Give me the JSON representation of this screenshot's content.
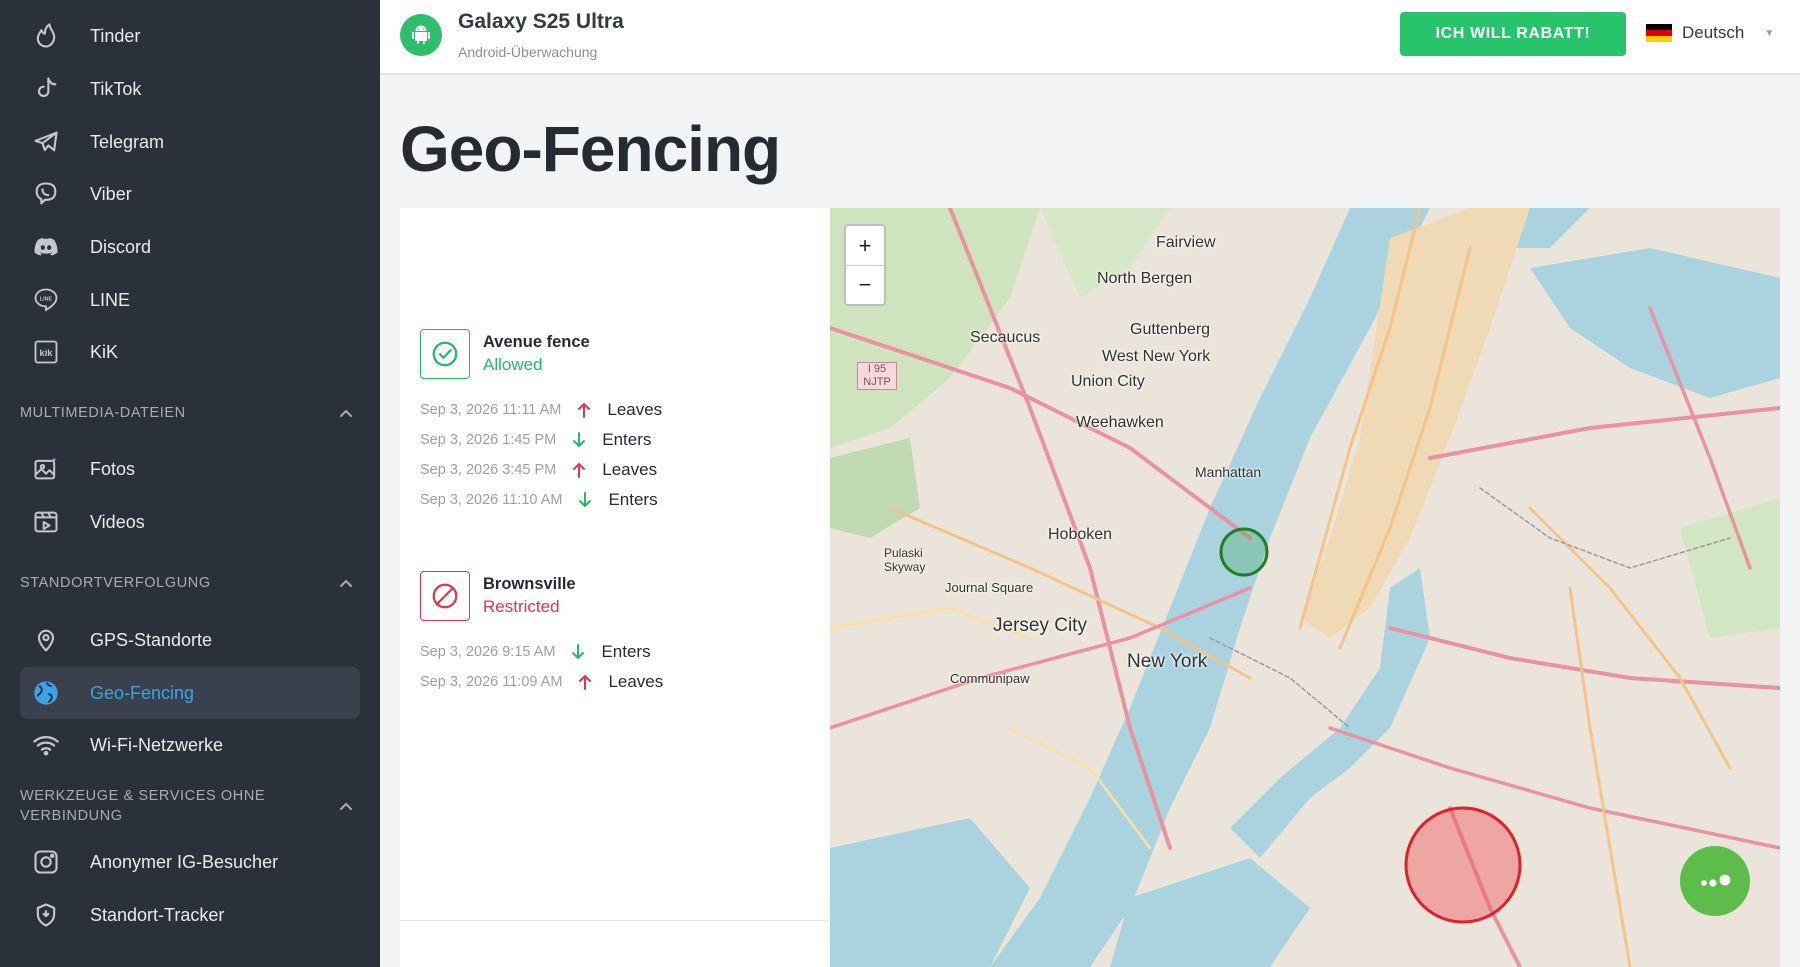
{
  "sidebar": {
    "items_top": [
      {
        "label": "Tinder",
        "icon": "tinder-icon"
      },
      {
        "label": "TikTok",
        "icon": "tiktok-icon"
      },
      {
        "label": "Telegram",
        "icon": "telegram-icon"
      },
      {
        "label": "Viber",
        "icon": "viber-icon"
      },
      {
        "label": "Discord",
        "icon": "discord-icon"
      },
      {
        "label": "LINE",
        "icon": "line-icon"
      },
      {
        "label": "KiK",
        "icon": "kik-icon"
      }
    ],
    "sections": [
      {
        "title": "MULTIMEDIA-DATEIEN",
        "items": [
          {
            "label": "Fotos",
            "icon": "photos-icon"
          },
          {
            "label": "Videos",
            "icon": "videos-icon"
          }
        ]
      },
      {
        "title": "STANDORTVERFOLGUNG",
        "items": [
          {
            "label": "GPS-Standorte",
            "icon": "gps-pin-icon"
          },
          {
            "label": "Geo-Fencing",
            "icon": "globe-icon",
            "active": true
          },
          {
            "label": "Wi-Fi-Netzwerke",
            "icon": "wifi-icon"
          }
        ]
      },
      {
        "title": "WERKZEUGE & SERVICES OHNE VERBINDUNG",
        "items": [
          {
            "label": "Anonymer IG-Besucher",
            "icon": "instagram-icon"
          },
          {
            "label": "Standort-Tracker",
            "icon": "location-tracker-icon"
          }
        ]
      }
    ],
    "active_color": "#3aa3e8"
  },
  "header": {
    "device_name": "Galaxy S25 Ultra",
    "device_sub": "Android-Überwachung",
    "cta_label": "ICH WILL RABATT!",
    "language": "Deutsch",
    "cta_color": "#27c46b"
  },
  "page": {
    "title": "Geo-Fencing"
  },
  "fences": [
    {
      "name": "Avenue fence",
      "status": "Allowed",
      "status_color": "#27b864",
      "events": [
        {
          "time": "Sep 3, 2026 11:11 AM",
          "action": "Leaves",
          "direction": "up"
        },
        {
          "time": "Sep 3, 2026 1:45 PM",
          "action": "Enters",
          "direction": "down"
        },
        {
          "time": "Sep 3, 2026 3:45 PM",
          "action": "Leaves",
          "direction": "up"
        },
        {
          "time": "Sep 3, 2026 11:10 AM",
          "action": "Enters",
          "direction": "down"
        }
      ]
    },
    {
      "name": "Brownsville",
      "status": "Restricted",
      "status_color": "#e0344f",
      "events": [
        {
          "time": "Sep 3, 2026 9:15 AM",
          "action": "Enters",
          "direction": "down"
        },
        {
          "time": "Sep 3, 2026 11:09 AM",
          "action": "Leaves",
          "direction": "up"
        }
      ]
    }
  ],
  "map": {
    "zoom_in": "+",
    "zoom_out": "−",
    "labels": [
      "Fairview",
      "North Bergen",
      "Secaucus",
      "Guttenberg",
      "West New York",
      "Union City",
      "Weehawken",
      "Manhattan",
      "Hoboken",
      "Journal Square",
      "Jersey City",
      "New York",
      "Communipaw",
      "Pulaski Skyway",
      "I 95 NJTP"
    ]
  }
}
